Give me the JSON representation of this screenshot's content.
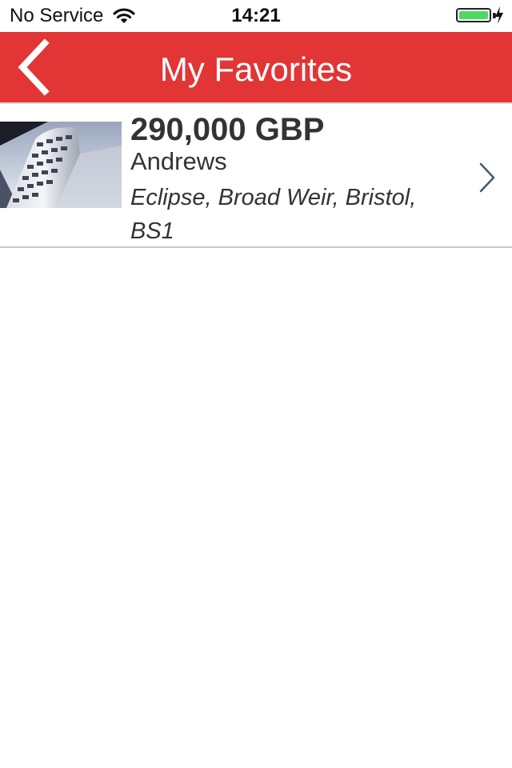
{
  "status_bar": {
    "carrier": "No Service",
    "time": "14:21",
    "battery_level": 1.0,
    "charging": true
  },
  "nav_bar": {
    "title": "My Favorites",
    "back_icon": "chevron-left-icon",
    "background_color": "#e13536"
  },
  "favorites": [
    {
      "price": "290,000 GBP",
      "agent": "Andrews",
      "address": "Eclipse, Broad Weir, Bristol, BS1",
      "thumbnail": "building-photo",
      "disclosure_icon": "chevron-right-icon"
    }
  ]
}
